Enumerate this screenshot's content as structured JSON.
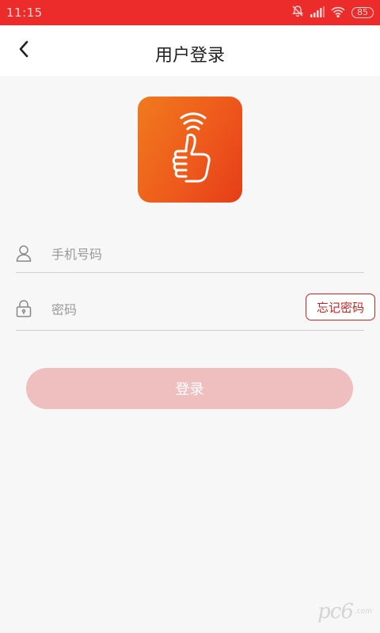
{
  "status_bar": {
    "time": "11:15",
    "battery": "85",
    "icons": [
      "alarm-off-icon",
      "signal-icon",
      "wifi-icon",
      "battery-icon"
    ]
  },
  "header": {
    "title": "用户登录",
    "back_icon": "chevron-left-icon"
  },
  "logo": {
    "icon": "thumbs-up-icon",
    "colors": [
      "#f07a1e",
      "#e63d18"
    ]
  },
  "form": {
    "phone": {
      "value": "",
      "placeholder": "手机号码",
      "icon": "user-icon"
    },
    "password": {
      "value": "",
      "placeholder": "密码",
      "icon": "lock-icon"
    },
    "forgot_label": "忘记密码",
    "login_label": "登录"
  },
  "watermark": {
    "text": "pc6",
    "sub": ".com"
  },
  "colors": {
    "brand": "#ec2b2b",
    "login_button": "#efbfbf",
    "forgot_border": "#cc2222"
  }
}
